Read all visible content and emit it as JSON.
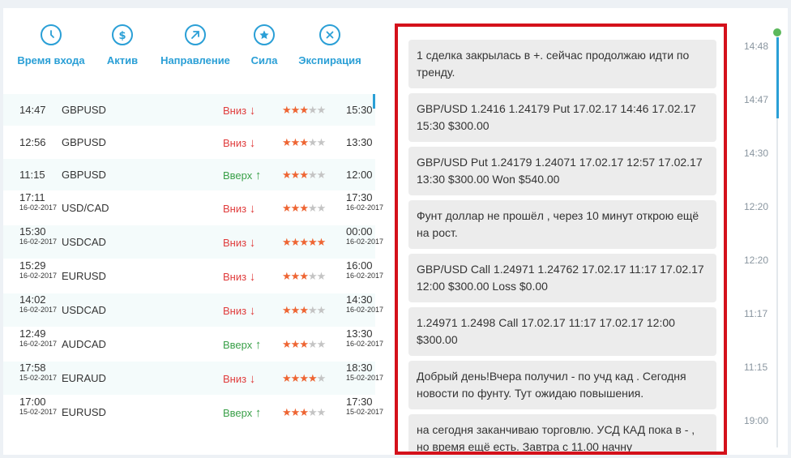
{
  "header": {
    "columns": [
      {
        "label": "Время входа",
        "icon": "clock-icon"
      },
      {
        "label": "Актив",
        "icon": "dollar-icon"
      },
      {
        "label": "Направление",
        "icon": "arrow-up-right-icon"
      },
      {
        "label": "Сила",
        "icon": "star-icon"
      },
      {
        "label": "Экспирация",
        "icon": "x-icon"
      }
    ]
  },
  "trades": [
    {
      "time": "14:47",
      "date": "",
      "asset": "GBPUSD",
      "direction": "Вниз",
      "arrow": "↓",
      "dir": "down",
      "strength": 3,
      "exp_time": "15:30",
      "exp_date": ""
    },
    {
      "time": "12:56",
      "date": "",
      "asset": "GBPUSD",
      "direction": "Вниз",
      "arrow": "↓",
      "dir": "down",
      "strength": 3,
      "exp_time": "13:30",
      "exp_date": ""
    },
    {
      "time": "11:15",
      "date": "",
      "asset": "GBPUSD",
      "direction": "Вверх",
      "arrow": "↑",
      "dir": "up",
      "strength": 3,
      "exp_time": "12:00",
      "exp_date": ""
    },
    {
      "time": "17:11",
      "date": "16-02-2017",
      "asset": "USD/CAD",
      "direction": "Вниз",
      "arrow": "↓",
      "dir": "down",
      "strength": 3,
      "exp_time": "17:30",
      "exp_date": "16-02-2017"
    },
    {
      "time": "15:30",
      "date": "16-02-2017",
      "asset": "USDCAD",
      "direction": "Вниз",
      "arrow": "↓",
      "dir": "down",
      "strength": 5,
      "exp_time": "00:00",
      "exp_date": "16-02-2017"
    },
    {
      "time": "15:29",
      "date": "16-02-2017",
      "asset": "EURUSD",
      "direction": "Вниз",
      "arrow": "↓",
      "dir": "down",
      "strength": 3,
      "exp_time": "16:00",
      "exp_date": "16-02-2017"
    },
    {
      "time": "14:02",
      "date": "16-02-2017",
      "asset": "USDCAD",
      "direction": "Вниз",
      "arrow": "↓",
      "dir": "down",
      "strength": 3,
      "exp_time": "14:30",
      "exp_date": "16-02-2017"
    },
    {
      "time": "12:49",
      "date": "16-02-2017",
      "asset": "AUDCAD",
      "direction": "Вверх",
      "arrow": "↑",
      "dir": "up",
      "strength": 3,
      "exp_time": "13:30",
      "exp_date": "16-02-2017"
    },
    {
      "time": "17:58",
      "date": "15-02-2017",
      "asset": "EURAUD",
      "direction": "Вниз",
      "arrow": "↓",
      "dir": "down",
      "strength": 4,
      "exp_time": "18:30",
      "exp_date": "15-02-2017"
    },
    {
      "time": "17:00",
      "date": "15-02-2017",
      "asset": "EURUSD",
      "direction": "Вверх",
      "arrow": "↑",
      "dir": "up",
      "strength": 3,
      "exp_time": "17:30",
      "exp_date": "15-02-2017"
    }
  ],
  "messages": [
    "1 сделка закрылась в +. сейчас продолжаю идти по тренду.",
    "GBP/USD 1.2416 1.24179 Put 17.02.17 14:46 17.02.17 15:30 $300.00",
    "GBP/USD Put 1.24179 1.24071 17.02.17 12:57 17.02.17 13:30 $300.00 Won $540.00",
    "Фунт доллар не прошёл , через 10 минут открою ещё на рост.",
    "GBP/USD Call 1.24971 1.24762 17.02.17 11:17 17.02.17 12:00 $300.00 Loss $0.00",
    "1.24971 1.2498 Call 17.02.17 11:17 17.02.17 12:00 $300.00",
    "Добрый день!Вчера получил - по учд кад . Сегодня новости по фунту. Тут ожидаю повышения.",
    "на сегодня заканчиваю торговлю. УСД КАД пока в - , но время ещё есть. Завтра с 11.00 начну"
  ],
  "timeline": [
    "14:48",
    "14:47",
    "14:30",
    "12:20",
    "12:20",
    "11:17",
    "11:15",
    "19:00"
  ],
  "colors": {
    "accent": "#2a9fd6",
    "down": "#e03c3c",
    "up": "#3aa049",
    "star": "#ee6533",
    "highlight_border": "#d4111b",
    "online": "#5cb85c"
  }
}
